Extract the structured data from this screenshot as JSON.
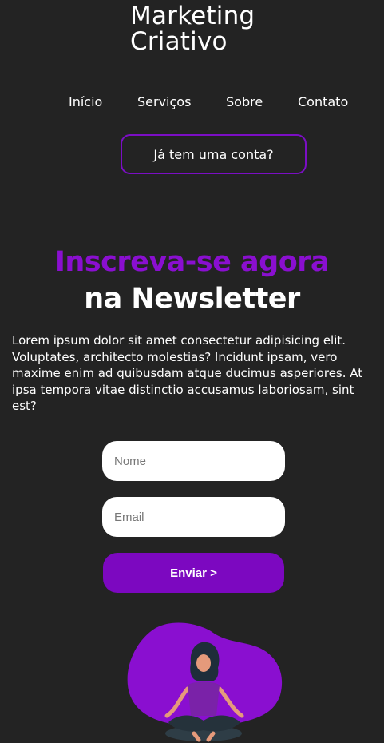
{
  "header": {
    "brand_line1": "Marketing",
    "brand_line2": "Criativo"
  },
  "nav": {
    "items": [
      {
        "label": "Início"
      },
      {
        "label": "Serviços"
      },
      {
        "label": "Sobre"
      },
      {
        "label": "Contato"
      }
    ],
    "login_label": "Já tem uma conta?"
  },
  "hero": {
    "headline_accent": "Inscreva-se agora",
    "headline_main": "na Newsletter",
    "intro": "Lorem ipsum dolor sit amet consectetur adipisicing elit. Voluptates, architecto molestias? Incidunt ipsam, vero maxime enim ad quibusdam atque ducimus asperiores. At ipsa tempora vitae distinctio accusamus laboriosam, sint est?"
  },
  "form": {
    "name_placeholder": "Nome",
    "email_placeholder": "Email",
    "submit_label": "Enviar >"
  },
  "colors": {
    "background": "#232323",
    "accent": "#8a0fd0",
    "button": "#7c08c0"
  }
}
